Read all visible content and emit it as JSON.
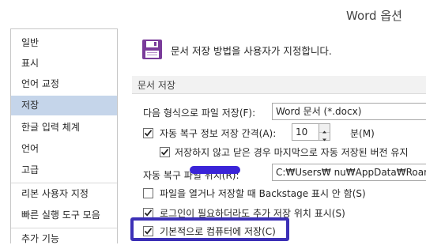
{
  "window": {
    "title": "Word 옵션"
  },
  "sidebar": {
    "items": [
      {
        "label": "일반"
      },
      {
        "label": "표시"
      },
      {
        "label": "언어 교정"
      },
      {
        "label": "저장",
        "selected": true
      },
      {
        "label": "한글 입력 체계"
      },
      {
        "label": "언어"
      },
      {
        "label": "고급"
      },
      {
        "label": "리본 사용자 지정"
      },
      {
        "label": "빠른 실행 도구 모음"
      },
      {
        "label": "추가 기능"
      }
    ]
  },
  "main": {
    "header_icon": "save-floppy-icon",
    "header_text": "문서 저장 방법을 사용자가 지정합니다.",
    "section_title": "문서 저장",
    "format_label": "다음 형식으로 파일 저장(F):",
    "format_value": "Word 문서 (*.docx)",
    "autorecover": {
      "label": "자동 복구 정보 저장 간격(A):",
      "checked": true,
      "minutes": "10",
      "unit_label": "분(M)"
    },
    "keep_last": {
      "label": "저장하지 않고 닫은 경우 마지막으로 자동 저장된 버전 유지",
      "checked": true
    },
    "autorecover_path_label": "자동 복구 파일 위치(R):",
    "autorecover_path_value": "C:₩Users₩          nu₩AppData₩Roam",
    "backstage": {
      "label": "파일을 열거나 저장할 때 Backstage 표시 안 함(S)",
      "checked": false
    },
    "additional_locations": {
      "label": "로그인이 필요하더라도 추가 저장 위치 표시(S)",
      "checked": true
    },
    "save_to_computer": {
      "label": "기본적으로 컴퓨터에 저장(C)",
      "checked": true
    }
  },
  "colors": {
    "selected_bg": "#c5d5ea",
    "highlight_border": "#3c30b6",
    "icon_purple": "#7a3b9a"
  }
}
